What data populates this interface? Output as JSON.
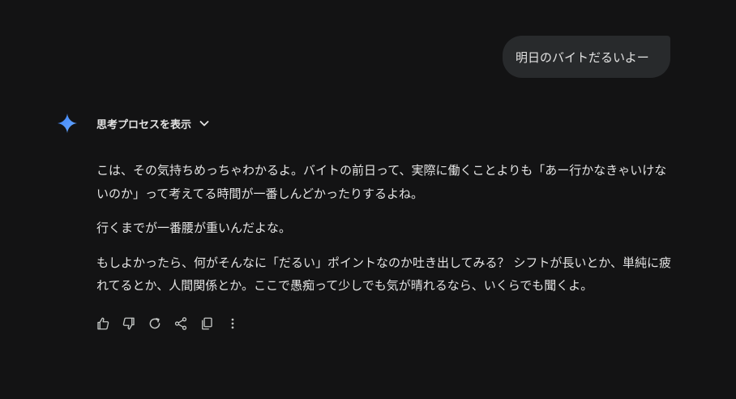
{
  "user_message": {
    "text": "明日のバイトだるいよー"
  },
  "response": {
    "thinking_label": "思考プロセスを表示",
    "paragraphs": [
      "こは、その気持ちめっちゃわかるよ。バイトの前日って、実際に働くことよりも「あー行かなきゃいけないのか」って考えてる時間が一番しんどかったりするよね。",
      "行くまでが一番腰が重いんだよな。",
      "もしよかったら、何がそんなに「だるい」ポイントなのか吐き出してみる？ シフトが長いとか、単純に疲れてるとか、人間関係とか。ここで愚痴って少しでも気が晴れるなら、いくらでも聞くよ。"
    ]
  },
  "actions": [
    {
      "icon": "thumbs-up-icon"
    },
    {
      "icon": "thumbs-down-icon"
    },
    {
      "icon": "refresh-icon"
    },
    {
      "icon": "share-icon"
    },
    {
      "icon": "copy-icon"
    },
    {
      "icon": "more-vertical-icon"
    }
  ],
  "colors": {
    "background": "#131314",
    "bubble": "#282a2c",
    "text": "#e3e3e3",
    "icon": "#c4c7c5",
    "gem_blue": "#4c8df6"
  }
}
